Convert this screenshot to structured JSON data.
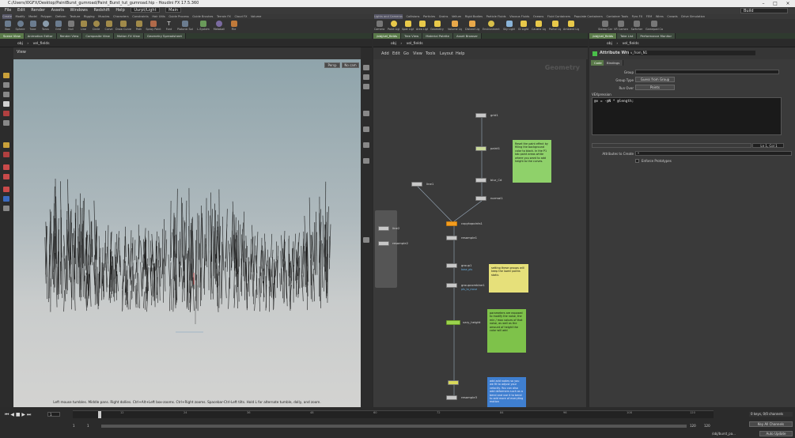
{
  "window": {
    "title": "C:/Users/i0GFX/Desktop/PaintBurst_gumroad/Paint_Burst_tut_gumroad.hip - Houdini FX 17.5.360"
  },
  "menu": [
    "File",
    "Edit",
    "Render",
    "Assets",
    "Windows",
    "Redshift",
    "Help"
  ],
  "desktop": "Uurpt/Light",
  "main_label": "Main",
  "build_label": "Build",
  "shelf_tabs": [
    "Create",
    "Modify",
    "Model",
    "Polygon",
    "Deform",
    "Texture",
    "Rigging",
    "Muscles",
    "Characters",
    "Constraints",
    "Hair Utils",
    "Guide Process",
    "Guide Brushes",
    "Terrain FX",
    "Cloud FX",
    "Volume"
  ],
  "shelf_tools": [
    "Box",
    "Sphere",
    "Tube",
    "Torus",
    "Grid",
    "Null",
    "Line",
    "Circle",
    "Curve",
    "Draw Curve",
    "Path",
    "Spray Paint",
    "Font",
    "Platonic Solids",
    "L-System",
    "Metaball",
    "File"
  ],
  "right_shelf_tabs": [
    "Lights and Cameras",
    "Collisions",
    "Particles",
    "Grains",
    "Vellum",
    "Rigid Bodies",
    "Particle Fluids",
    "Viscous Fluids",
    "Oceans",
    "Fluid Containers",
    "Populate Containers",
    "Container Tools",
    "Pyro FX",
    "FEM",
    "Wires",
    "Crowds",
    "Drive Simulation"
  ],
  "light_tools": [
    "Camera",
    "Point Light",
    "Spot Light",
    "Area Light",
    "Geometry Light",
    "Volume Light",
    "Distant Light",
    "Environment Light",
    "Sky Light",
    "GI Light",
    "Caustic Light",
    "Portal Light",
    "Ambient Light",
    "Stereo Camera",
    "VR Camera",
    "Switcher",
    "Gamepad Camera"
  ],
  "left_tabs": [
    "Scene View",
    "Animation Editor",
    "Render View",
    "Composite View",
    "Motion FX View",
    "Geometry Spreadsheet"
  ],
  "mid_tabs": [
    "/obj/vel_fields",
    "Tree View",
    "Material Palette",
    "Asset Browser"
  ],
  "right_tabs": [
    "/obj/vel_fields",
    "Take List",
    "Performance Monitor"
  ],
  "path": {
    "obj": "obj",
    "node": "vel_fields"
  },
  "viewport": {
    "label": "View",
    "persp": "Persp",
    "cam": "No cam",
    "status_hint": "Left mouse tumbles. Middle pans. Right dollies. Ctrl+Alt+Left box-zooms. Ctrl+Right zooms. Spacebar-Ctrl-Left tilts. Hold L for alternate tumble, dolly, and zoom."
  },
  "network": {
    "menu": [
      "Add",
      "Edit",
      "Go",
      "View",
      "Tools",
      "Layout",
      "Help"
    ],
    "watermark": "Geometry",
    "nodes": [
      {
        "name": "grid1"
      },
      {
        "name": "paint1"
      },
      {
        "name": "blur_Cd"
      },
      {
        "name": "normal1"
      },
      {
        "name": "line1"
      },
      {
        "name": "copytopoints1"
      },
      {
        "name": "line2"
      },
      {
        "name": "resample1"
      },
      {
        "name": "resample2"
      },
      {
        "name": "group1"
      },
      {
        "name": "groupcombine1"
      },
      {
        "name": "vary_height"
      },
      {
        "name": "resample3"
      }
    ],
    "node_subs": {
      "group1": "base_pts",
      "groupcombine1": "pts_to_move"
    },
    "notes": [
      {
        "text": "Reset the paint effect by filling the background color to black. In the P1 tab paint areas white where you want to add height to the curves.",
        "color": "#8fd16a"
      },
      {
        "text": "setting these groups will keep the lower points static.",
        "color": "#e6e07a"
      },
      {
        "text": "parameters are exposed to modify the noise, the min / max values of that noise, as well as the amount of height the color will add",
        "color": "#7ec24a"
      },
      {
        "text": "add add nodes so you we fit to adjust your velocity. You can also add deformers such as a bend and use it to bend to add more of everyting motion",
        "color": "#3f7fd0"
      }
    ]
  },
  "parms": {
    "node_type": "Attribute Wrangle",
    "node_name": "v_from_N1",
    "tabs": [
      "Code",
      "Bindings"
    ],
    "group_label": "Group",
    "group_type_label": "Group Type",
    "group_type_value": "Guess from Group",
    "run_over_label": "Run Over",
    "run_over_value": "Points",
    "vex_label": "VEXpression",
    "vex_code": "@v = -@N * @length;",
    "cursor_pos": "Ln 1, Col 1",
    "attrs_label": "Attributes to Create",
    "attrs_value": "*",
    "enforce_label": "Enforce Prototypes"
  },
  "timeline": {
    "frame": "1",
    "start": "1",
    "end_a": "120",
    "end_b": "120",
    "ticks": [
      "12",
      "24",
      "36",
      "48",
      "60",
      "72",
      "84",
      "96",
      "108",
      "120"
    ],
    "channels_label": "0 keys, 0/0 channels",
    "key_all": "Key All Channels",
    "auto_update": "Auto Update",
    "status_path": "/obj/burst_pa..."
  },
  "colors": {
    "accent": "#f39c1f",
    "node_green": "#9bd34d",
    "node_grey": "#c8c8c8",
    "tab_active": "#5a7a4a"
  }
}
